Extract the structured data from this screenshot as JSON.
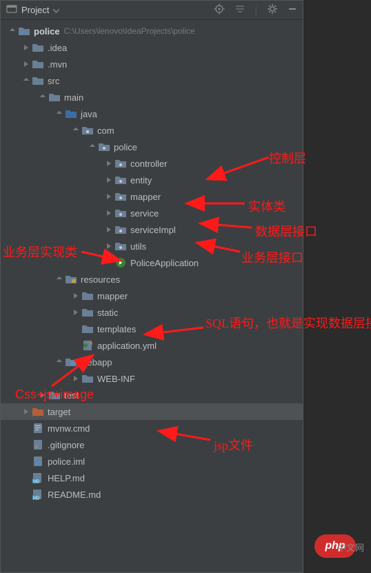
{
  "header": {
    "title": "Project",
    "dropdown_icon": "chevron-down"
  },
  "root": {
    "name": "police",
    "path": "C:\\Users\\lenovo\\IdeaProjects\\police"
  },
  "folders": {
    "idea": ".idea",
    "mvn": ".mvn",
    "src": "src",
    "main": "main",
    "java": "java",
    "com": "com",
    "police": "police",
    "controller": "controller",
    "entity": "entity",
    "mapper": "mapper",
    "service": "service",
    "serviceImpl": "serviceImpl",
    "utils": "utils",
    "policeApp": "PoliceApplication",
    "resources": "resources",
    "mapper2": "mapper",
    "static": "static",
    "templates": "templates",
    "appyml": "application.yml",
    "webapp": "webapp",
    "webinf": "WEB-INF",
    "test": "test",
    "target": "target",
    "mvnwcmd": "mvnw.cmd",
    "gitignore": ".gitignore",
    "policeiml": "police.iml",
    "helpmd": "HELP.md",
    "readmemd": "README.md"
  },
  "annotations": {
    "controlLayer": "控制层",
    "entityClass": "实体类",
    "dataLayerInterface": "数据层接口",
    "businessImpl": "业务层实现类",
    "businessInterface": "业务层接口",
    "sql": "SQL语句，也就是实现数据层接口的",
    "cssjs": "Css+js+image",
    "jsp": "jsp文件"
  },
  "badge": {
    "text": "php",
    "sub": "中文网"
  }
}
